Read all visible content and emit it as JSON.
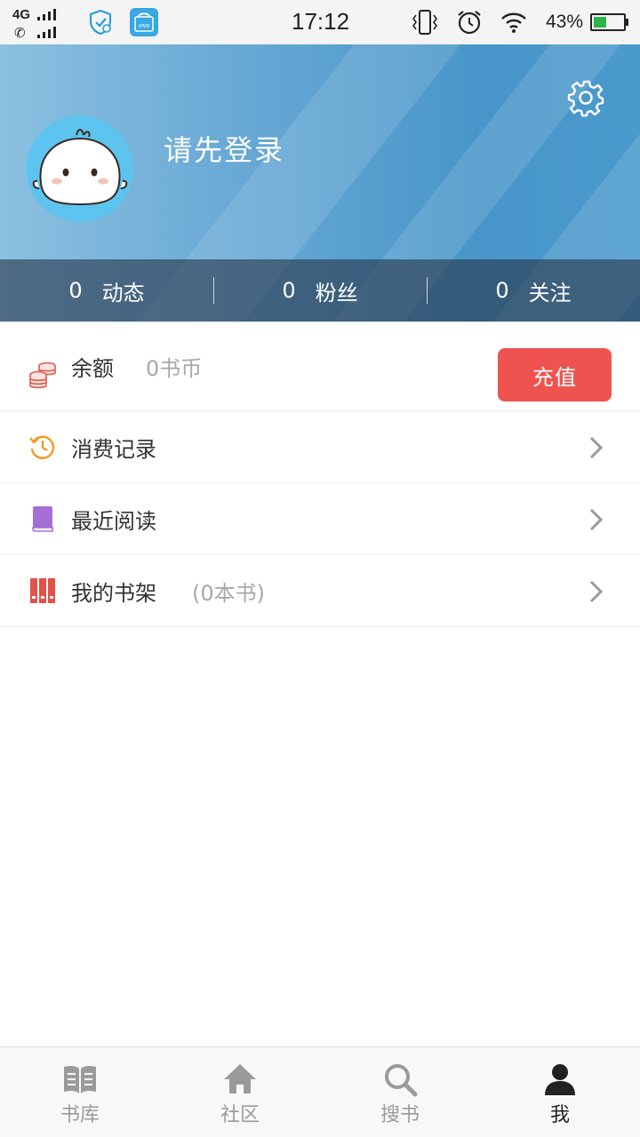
{
  "status_bar": {
    "network": "4G",
    "time": "17:12",
    "battery_percent": "43%",
    "battery_level": 0.43,
    "icons": [
      "signal-icon",
      "call-signal-icon",
      "security-app-icon",
      "vivo-store-icon",
      "vibrate-icon",
      "alarm-icon",
      "wifi-icon",
      "battery-icon"
    ]
  },
  "header": {
    "login_prompt": "请先登录",
    "settings_icon": "gear-icon",
    "avatar_icon": "mascot-avatar",
    "stats": [
      {
        "value": "0",
        "label": "动态"
      },
      {
        "value": "0",
        "label": "粉丝"
      },
      {
        "value": "0",
        "label": "关注"
      }
    ]
  },
  "menu": {
    "balance": {
      "label": "余额",
      "value": "0书币",
      "button": "充值",
      "icon": "coins-icon"
    },
    "items": [
      {
        "label": "消费记录",
        "sub": "",
        "icon": "history-icon"
      },
      {
        "label": "最近阅读",
        "sub": "",
        "icon": "book-icon"
      },
      {
        "label": "我的书架",
        "sub": "(0本书)",
        "icon": "bookshelf-icon"
      }
    ]
  },
  "tabs": [
    {
      "label": "书库",
      "icon": "library-icon",
      "active": false
    },
    {
      "label": "社区",
      "icon": "home-icon",
      "active": false
    },
    {
      "label": "搜书",
      "icon": "search-icon",
      "active": false
    },
    {
      "label": "我",
      "icon": "person-icon",
      "active": true
    }
  ],
  "colors": {
    "accent_red": "#ef5350",
    "header_blue": "#4896c9",
    "active_tab": "#222222",
    "inactive_tab": "#9a9a9a"
  }
}
